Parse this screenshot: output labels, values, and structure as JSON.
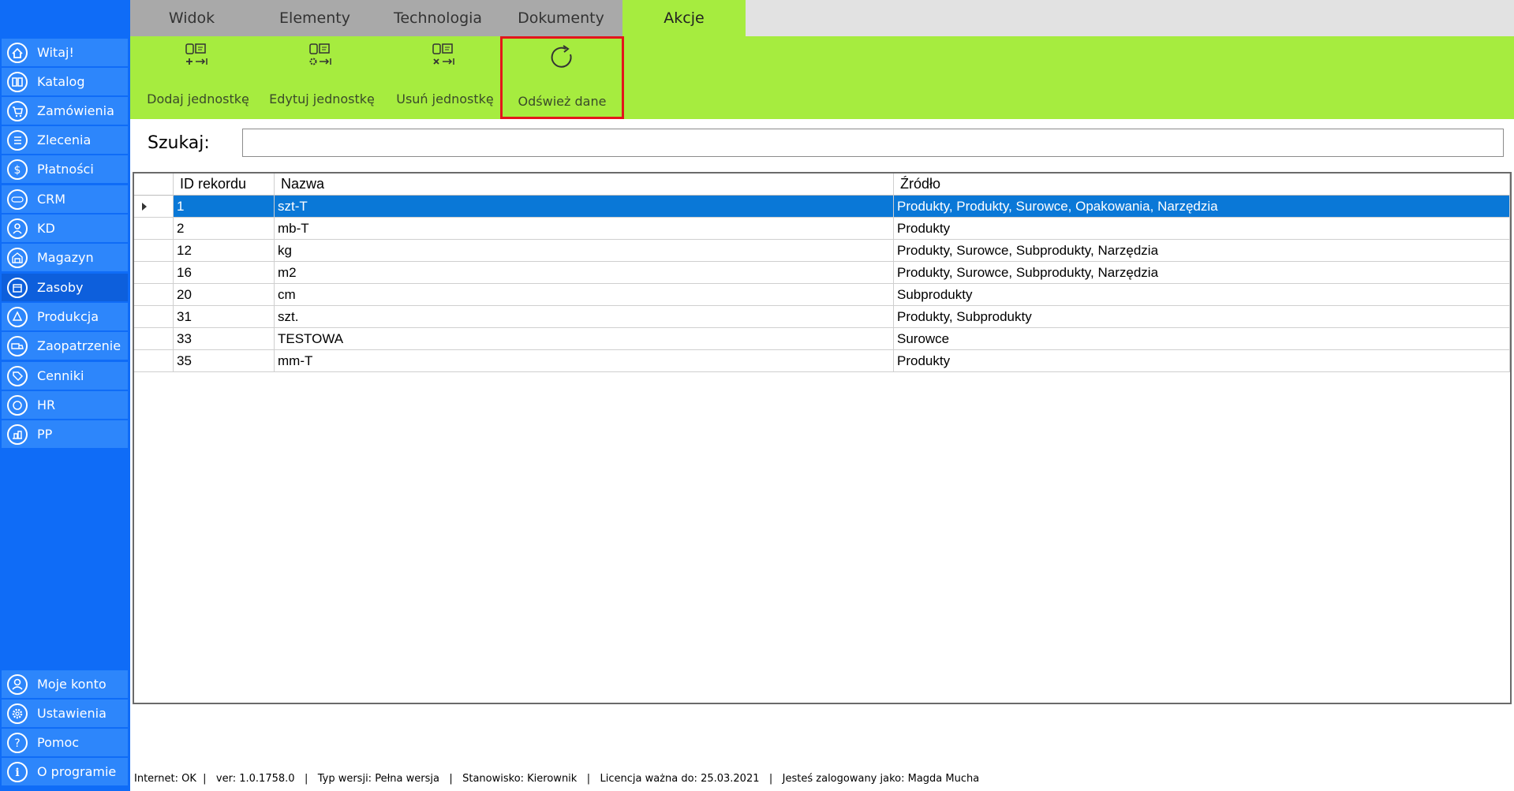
{
  "sidebar": {
    "items": [
      {
        "label": "Witaj!",
        "icon": "home-icon"
      },
      {
        "label": "Katalog",
        "icon": "book-icon"
      },
      {
        "label": "Zamówienia",
        "icon": "cart-icon"
      },
      {
        "label": "Zlecenia",
        "icon": "list-icon"
      },
      {
        "label": "Płatności",
        "icon": "dollar-icon"
      },
      {
        "label": "CRM",
        "icon": "crm-icon"
      },
      {
        "label": "KD",
        "icon": "user-icon"
      },
      {
        "label": "Magazyn",
        "icon": "warehouse-icon"
      },
      {
        "label": "Zasoby",
        "icon": "resources-icon"
      },
      {
        "label": "Produkcja",
        "icon": "production-icon"
      },
      {
        "label": "Zaopatrzenie",
        "icon": "truck-icon"
      },
      {
        "label": "Cenniki",
        "icon": "tag-icon"
      },
      {
        "label": "HR",
        "icon": "hr-icon"
      },
      {
        "label": "PP",
        "icon": "pp-icon"
      }
    ],
    "bottom": [
      {
        "label": "Moje konto",
        "icon": "account-icon"
      },
      {
        "label": "Ustawienia",
        "icon": "gear-icon"
      },
      {
        "label": "Pomoc",
        "icon": "help-icon"
      },
      {
        "label": "O programie",
        "icon": "info-icon"
      }
    ]
  },
  "tabs": [
    {
      "label": "Widok"
    },
    {
      "label": "Elementy"
    },
    {
      "label": "Technologia"
    },
    {
      "label": "Dokumenty"
    },
    {
      "label": "Akcje"
    }
  ],
  "ribbon": {
    "add_label": "Dodaj jednostkę",
    "edit_label": "Edytuj jednostkę",
    "delete_label": "Usuń jednostkę",
    "refresh_label": "Odśwież dane"
  },
  "search": {
    "label": "Szukaj:",
    "value": ""
  },
  "table": {
    "columns": [
      "ID rekordu",
      "Nazwa",
      "Źródło"
    ],
    "rows": [
      {
        "id": "1",
        "name": "szt-T",
        "source": "Produkty, Produkty, Surowce, Opakowania, Narzędzia"
      },
      {
        "id": "2",
        "name": "mb-T",
        "source": "Produkty"
      },
      {
        "id": "12",
        "name": "kg",
        "source": "Produkty, Surowce, Subprodukty, Narzędzia"
      },
      {
        "id": "16",
        "name": "m2",
        "source": "Produkty, Surowce, Subprodukty, Narzędzia"
      },
      {
        "id": "20",
        "name": "cm",
        "source": "Subprodukty"
      },
      {
        "id": "31",
        "name": "szt.",
        "source": "Produkty, Subprodukty"
      },
      {
        "id": "33",
        "name": "TESTOWA",
        "source": "Surowce"
      },
      {
        "id": "35",
        "name": "mm-T",
        "source": "Produkty"
      }
    ]
  },
  "status": {
    "text": "Internet: OK  |   ver: 1.0.1758.0   |   Typ wersji: Pełna wersja   |   Stanowisko: Kierownik   |   Licencja ważna do: 25.03.2021   |   Jesteś zalogowany jako: Magda Mucha"
  },
  "colors": {
    "sidebar": "#0f6cf7",
    "ribbon": "#a6ec3f",
    "selection": "#0a78d7",
    "highlight": "#e3161b"
  }
}
